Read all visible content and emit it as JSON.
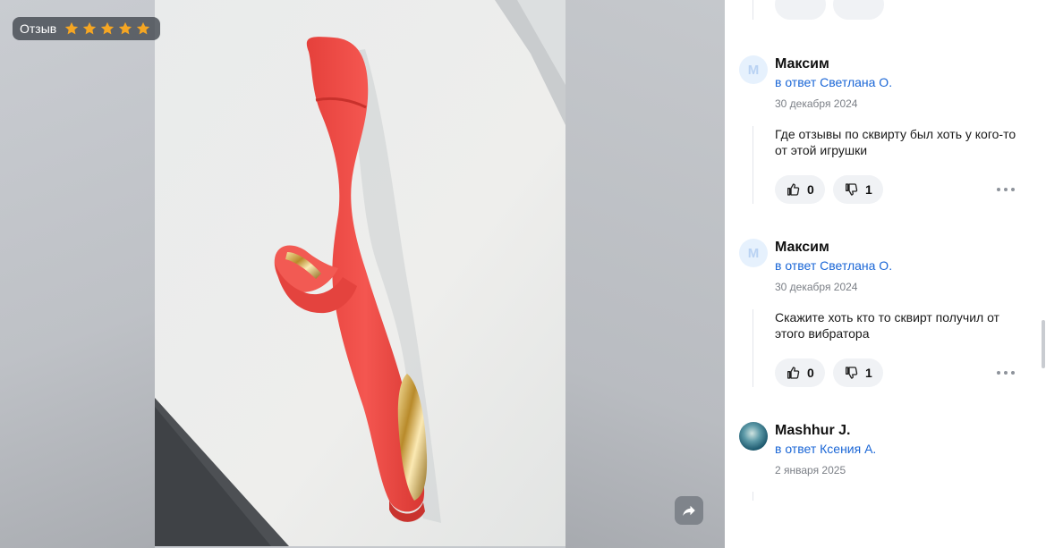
{
  "viewer": {
    "badge_label": "Отзыв",
    "rating": 5,
    "rating_max": 5,
    "star_color": "#f5a623"
  },
  "comments": [
    {
      "author": "Максим",
      "reply_to": "в ответ Светлана О.",
      "date": "30 декабря 2024",
      "text": "Где отзывы по сквирту был хоть у кого-то от этой игрушки",
      "likes": "0",
      "dislikes": "1"
    },
    {
      "author": "Максим",
      "reply_to": "в ответ Светлана О.",
      "date": "30 декабря 2024",
      "text": "Скажите хоть кто то сквирт получил от этого вибратора",
      "likes": "0",
      "dislikes": "1"
    },
    {
      "author": "Mashhur J.",
      "reply_to": "в ответ Ксения А.",
      "date": "2 января 2025"
    }
  ],
  "icons": {
    "star": "star-icon",
    "like": "thumbs-up-icon",
    "dislike": "thumbs-down-icon",
    "more": "more-dots-icon",
    "share": "share-arrow-icon"
  },
  "colors": {
    "link": "#1a66d6",
    "pill": "#f0f2f5",
    "photo_product": "#ef4b45"
  }
}
